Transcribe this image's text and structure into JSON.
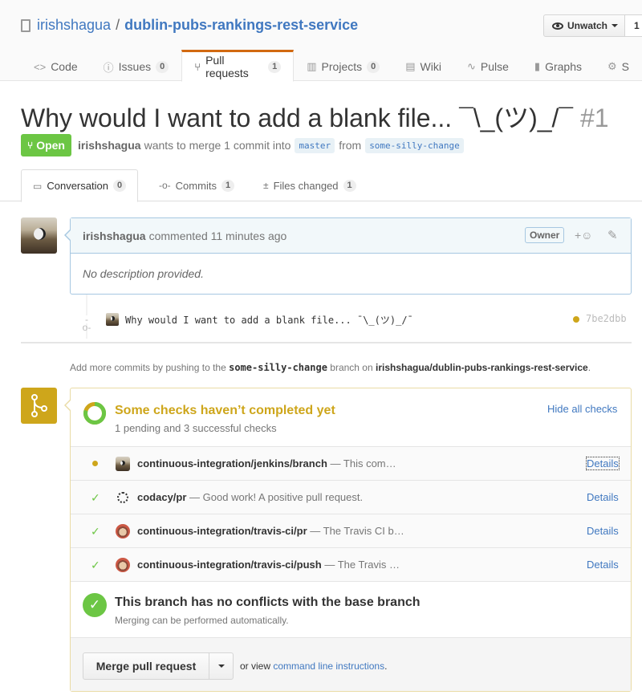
{
  "repo": {
    "owner": "irishshagua",
    "separator": "/",
    "name": "dublin-pubs-rankings-rest-service",
    "watch_label": "Unwatch",
    "watch_count": "1"
  },
  "nav": [
    {
      "icon": "<>",
      "label": "Code",
      "count": ""
    },
    {
      "icon": "ⓘ",
      "label": "Issues",
      "count": "0"
    },
    {
      "icon": "⑂",
      "label": "Pull requests",
      "count": "1"
    },
    {
      "icon": "▥",
      "label": "Projects",
      "count": "0"
    },
    {
      "icon": "▤",
      "label": "Wiki",
      "count": ""
    },
    {
      "icon": "∿",
      "label": "Pulse",
      "count": ""
    },
    {
      "icon": "▮",
      "label": "Graphs",
      "count": ""
    },
    {
      "icon": "⚙",
      "label": "S",
      "count": ""
    }
  ],
  "pr": {
    "title": "Why would I want to add a blank file... ¯\\_(ツ)_/¯",
    "number": "#1",
    "state": "Open",
    "author": "irishshagua",
    "merge_text": "wants to merge 1 commit into",
    "base_branch": "master",
    "from_text": "from",
    "head_branch": "some-silly-change"
  },
  "tabs": [
    {
      "icon": "▭",
      "label": "Conversation",
      "count": "0"
    },
    {
      "icon": "-o-",
      "label": "Commits",
      "count": "1"
    },
    {
      "icon": "±",
      "label": "Files changed",
      "count": "1"
    }
  ],
  "comment": {
    "author": "irishshagua",
    "time": "commented 11 minutes ago",
    "badge": "Owner",
    "reaction": "+☺",
    "edit": "✎",
    "body": "No description provided."
  },
  "commit": {
    "message": "Why would I want to add a blank file... ¯\\_(ツ)_/¯",
    "sha": "7be2dbb"
  },
  "hint": {
    "prefix": "Add more commits by pushing to the",
    "branch": "some-silly-change",
    "mid": "branch on",
    "repo": "irishshagua/dublin-pubs-rankings-rest-service",
    "end": "."
  },
  "checks": {
    "title": "Some checks haven’t completed yet",
    "subtitle": "1 pending and 3 successful checks",
    "hide": "Hide all checks",
    "items": [
      {
        "status": "pending",
        "context": "continuous-integration/jenkins/branch",
        "desc": "— This com…",
        "details": "Details"
      },
      {
        "status": "success",
        "context": "codacy/pr",
        "desc": "— Good work! A positive pull request.",
        "details": "Details"
      },
      {
        "status": "success",
        "context": "continuous-integration/travis-ci/pr",
        "desc": "— The Travis CI b…",
        "details": "Details"
      },
      {
        "status": "success",
        "context": "continuous-integration/travis-ci/push",
        "desc": "— The Travis …",
        "details": "Details"
      }
    ]
  },
  "merge": {
    "title": "This branch has no conflicts with the base branch",
    "subtitle": "Merging can be performed automatically.",
    "button": "Merge pull request",
    "alt_prefix": "or view",
    "alt_link": "command line instructions",
    "alt_suffix": "."
  },
  "colors": {
    "accent": "#4078c0",
    "open_green": "#6cc644",
    "pending_yellow": "#cea61b",
    "selected_tab_border": "#d26911"
  }
}
